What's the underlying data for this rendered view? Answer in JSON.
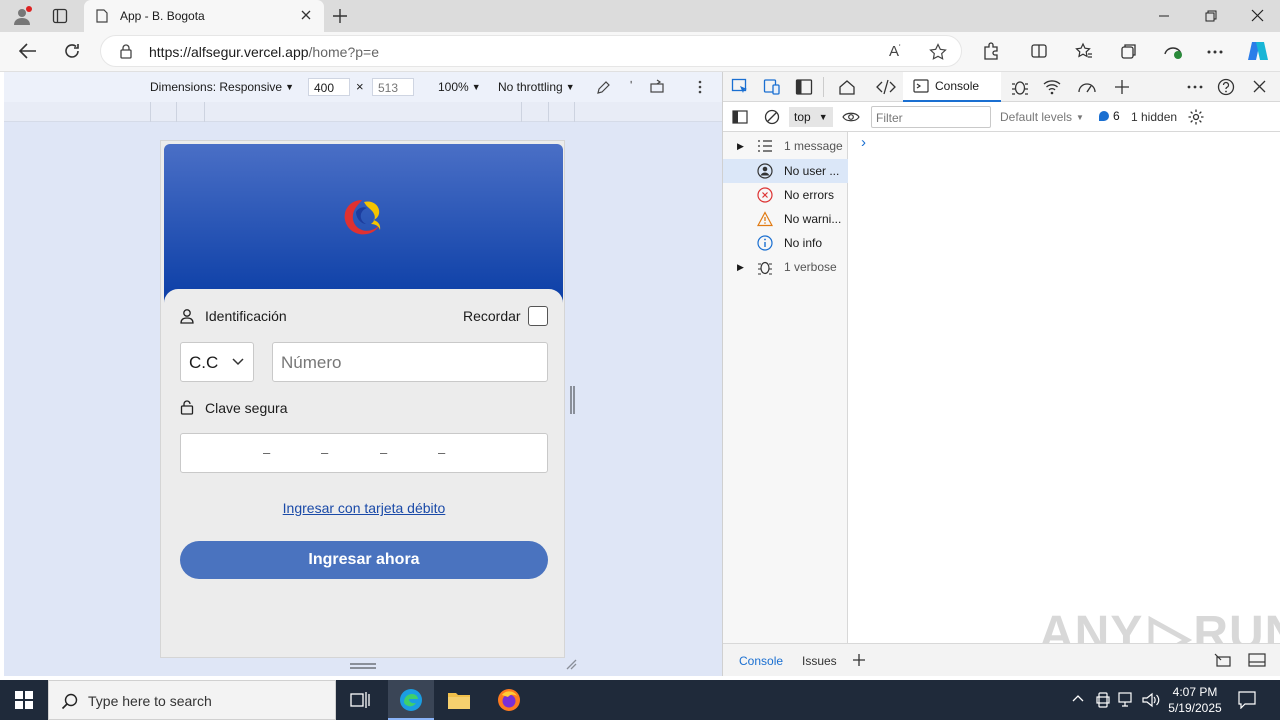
{
  "browser": {
    "tab_title": "App - B. Bogota",
    "url_host": "https://alfsegur.vercel.app",
    "url_path": "/home?p=e"
  },
  "device_toolbar": {
    "dimensions_label": "Dimensions: Responsive",
    "width": "400",
    "times": "×",
    "height": "513",
    "zoom": "100%",
    "throttling": "No throttling"
  },
  "app": {
    "id_label": "Identificación",
    "remember_label": "Recordar",
    "doc_type": "C.C",
    "number_placeholder": "Número",
    "password_label": "Clave segura",
    "pin_slots": [
      "–",
      "–",
      "–",
      "–"
    ],
    "debit_link": "Ingresar con tarjeta débito",
    "submit_label": "Ingresar ahora"
  },
  "devtools": {
    "active_tab": "Console",
    "context": "top",
    "filter_placeholder": "Filter",
    "levels": "Default levels",
    "issues_count": "6",
    "hidden": "1 hidden",
    "sidebar": [
      {
        "label": "1 message"
      },
      {
        "label": "No user ..."
      },
      {
        "label": "No errors"
      },
      {
        "label": "No warni..."
      },
      {
        "label": "No info"
      },
      {
        "label": "1 verbose"
      }
    ],
    "prompt": "›",
    "bottom_tabs": [
      "Console",
      "Issues"
    ]
  },
  "taskbar": {
    "search_placeholder": "Type here to search",
    "time": "4:07 PM",
    "date": "5/19/2025"
  },
  "watermark": "ANY RUN",
  "colors": {
    "accent": "#4a73bf",
    "hero_top": "#4a6fc6",
    "hero_bottom": "#0b3ea6",
    "link": "#1a4aa8"
  }
}
